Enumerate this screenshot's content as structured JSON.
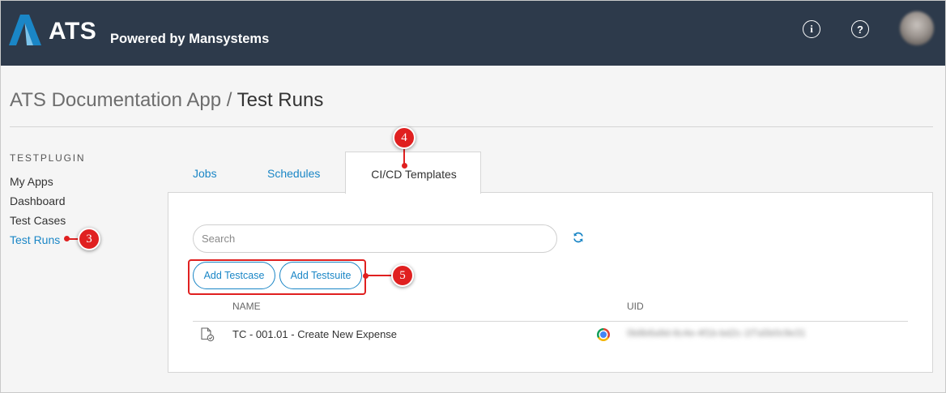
{
  "header": {
    "logo_text": "ATS",
    "logo_subtitle": "Powered by Mansystems",
    "info_icon": "i",
    "help_icon": "?"
  },
  "breadcrumb": {
    "app": "ATS Documentation App",
    "separator": " / ",
    "current": "Test Runs"
  },
  "sidebar": {
    "section": "TESTPLUGIN",
    "items": [
      {
        "label": "My Apps"
      },
      {
        "label": "Dashboard"
      },
      {
        "label": "Test Cases"
      },
      {
        "label": "Test Runs"
      }
    ]
  },
  "tabs": [
    {
      "label": "Jobs"
    },
    {
      "label": "Schedules"
    },
    {
      "label": "CI/CD Templates"
    }
  ],
  "search": {
    "placeholder": "Search"
  },
  "buttons": {
    "add_testcase": "Add Testcase",
    "add_testsuite": "Add Testsuite"
  },
  "table": {
    "columns": [
      "NAME",
      "UID"
    ],
    "rows": [
      {
        "name": "TC - 001.01 - Create New Expense",
        "uid": "0b8b6a9d-6c4e-4f1b-bd2c-1f7a5b0c9e31"
      }
    ]
  },
  "callouts": [
    "3",
    "4",
    "5"
  ],
  "colors": {
    "header_bg": "#2d3a4b",
    "accent": "#1a86c6",
    "callout": "#e02020"
  }
}
